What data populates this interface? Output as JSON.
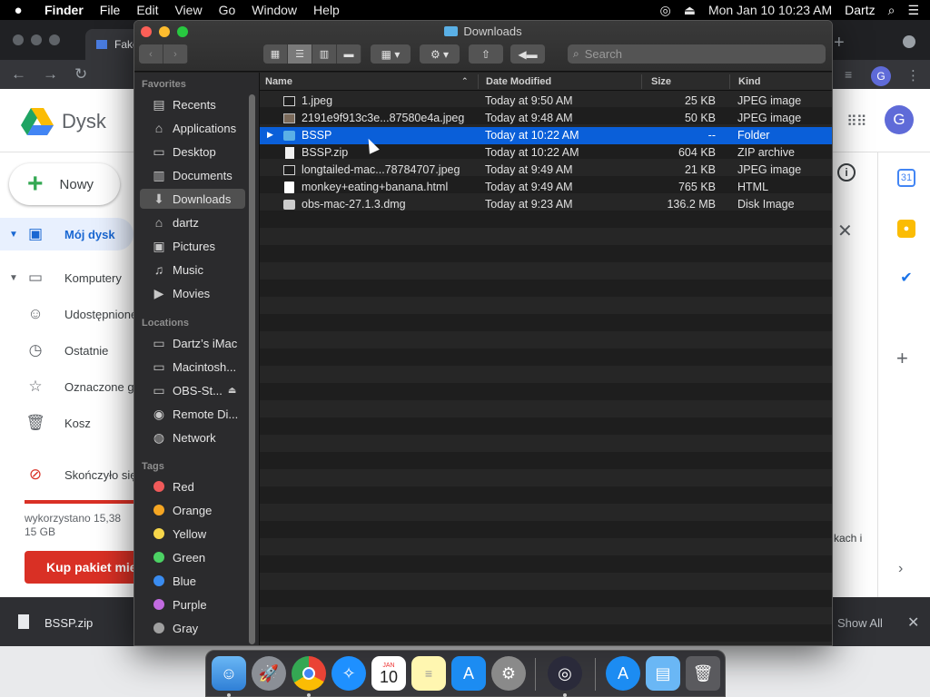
{
  "menubar": {
    "app": "Finder",
    "items": [
      "File",
      "Edit",
      "View",
      "Go",
      "Window",
      "Help"
    ],
    "clock": "Mon Jan 10  10:23 AM",
    "user": "Dartz"
  },
  "browser": {
    "tab_title": "FakeB",
    "drive_title": "Dysk",
    "avatar_letter": "G",
    "new_label": "Nowy",
    "nav": [
      {
        "label": "Mój dysk"
      },
      {
        "label": "Komputery"
      },
      {
        "label": "Udostępnione"
      },
      {
        "label": "Ostatnie"
      },
      {
        "label": "Oznaczone g"
      },
      {
        "label": "Kosz"
      }
    ],
    "storage_warning": "Skończyło się",
    "storage_text": "wykorzystano 15,38",
    "storage_total": "15 GB",
    "storage_fraction": 1.0,
    "buy_label": "Kup pakiet mie",
    "side_text": "kach i",
    "download": {
      "file": "BSSP.zip",
      "show_all": "Show All"
    },
    "calendar_day": "31"
  },
  "finder": {
    "title": "Downloads",
    "search_placeholder": "Search",
    "sidebar": {
      "favorites_header": "Favorites",
      "favorites": [
        {
          "label": "Recents",
          "icon": "recents-icon"
        },
        {
          "label": "Applications",
          "icon": "applications-icon"
        },
        {
          "label": "Desktop",
          "icon": "desktop-icon"
        },
        {
          "label": "Documents",
          "icon": "documents-icon"
        },
        {
          "label": "Downloads",
          "icon": "downloads-icon"
        },
        {
          "label": "dartz",
          "icon": "home-icon"
        },
        {
          "label": "Pictures",
          "icon": "pictures-icon"
        },
        {
          "label": "Music",
          "icon": "music-icon"
        },
        {
          "label": "Movies",
          "icon": "movies-icon"
        }
      ],
      "locations_header": "Locations",
      "locations": [
        {
          "label": "Dartz’s iMac",
          "icon": "imac-icon"
        },
        {
          "label": "Macintosh...",
          "icon": "disk-icon"
        },
        {
          "label": "OBS-St...",
          "icon": "disk-icon"
        },
        {
          "label": "Remote Di...",
          "icon": "remote-disc-icon"
        },
        {
          "label": "Network",
          "icon": "network-icon"
        }
      ],
      "tags_header": "Tags",
      "tags": [
        {
          "label": "Red",
          "color": "#f05a5a"
        },
        {
          "label": "Orange",
          "color": "#f5a623"
        },
        {
          "label": "Yellow",
          "color": "#f7d64a"
        },
        {
          "label": "Green",
          "color": "#4cd264"
        },
        {
          "label": "Blue",
          "color": "#3a8cf0"
        },
        {
          "label": "Purple",
          "color": "#c26be0"
        },
        {
          "label": "Gray",
          "color": "#a0a0a0"
        }
      ]
    },
    "columns": {
      "name": "Name",
      "date": "Date Modified",
      "size": "Size",
      "kind": "Kind"
    },
    "files": [
      {
        "name": "1.jpeg",
        "date": "Today at 9:50 AM",
        "size": "25 KB",
        "kind": "JPEG image"
      },
      {
        "name": "2191e9f913c3e...87580e4a.jpeg",
        "date": "Today at 9:48 AM",
        "size": "50 KB",
        "kind": "JPEG image"
      },
      {
        "name": "BSSP",
        "date": "Today at 10:22 AM",
        "size": "--",
        "kind": "Folder"
      },
      {
        "name": "BSSP.zip",
        "date": "Today at 10:22 AM",
        "size": "604 KB",
        "kind": "ZIP archive"
      },
      {
        "name": "longtailed-mac...78784707.jpeg",
        "date": "Today at 9:49 AM",
        "size": "21 KB",
        "kind": "JPEG image"
      },
      {
        "name": "monkey+eating+banana.html",
        "date": "Today at 9:49 AM",
        "size": "765 KB",
        "kind": "HTML"
      },
      {
        "name": "obs-mac-27.1.3.dmg",
        "date": "Today at 9:23 AM",
        "size": "136.2 MB",
        "kind": "Disk Image"
      }
    ]
  },
  "dock": {
    "calendar_month": "JAN",
    "calendar_day": "10"
  }
}
